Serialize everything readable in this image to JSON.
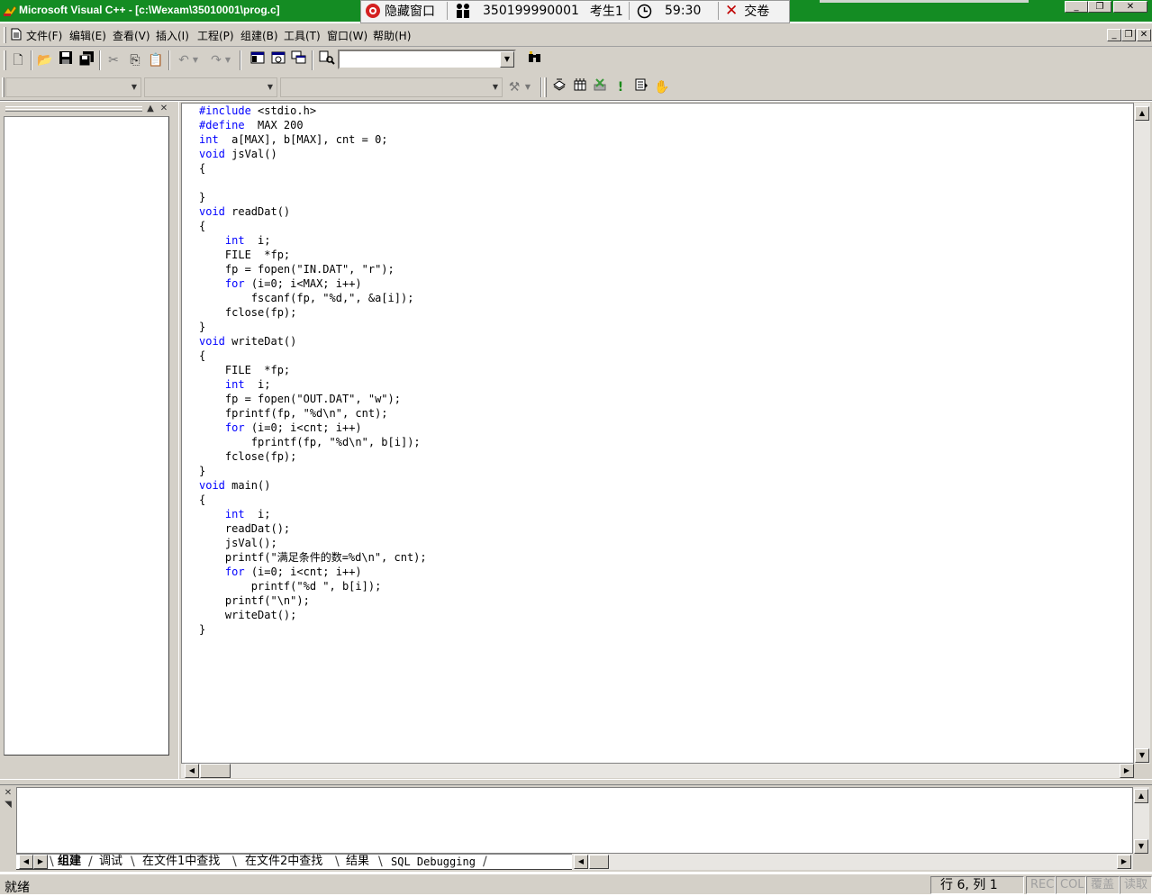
{
  "window": {
    "title": "Microsoft Visual C++ - [c:\\Wexam\\35010001\\prog.c]",
    "minimize": "_",
    "restore": "❐",
    "close": "✕"
  },
  "exam_bar": {
    "hide_label": "隐藏窗口",
    "student_id": "350199990001",
    "student_name": "考生1",
    "timer": "59:30",
    "submit_label": "交卷"
  },
  "menu": {
    "items": [
      "文件(F)",
      "编辑(E)",
      "查看(V)",
      "插入(I)",
      "工程(P)",
      "组建(B)",
      "工具(T)",
      "窗口(W)",
      "帮助(H)"
    ]
  },
  "icons": {
    "new": "new-text-file-icon",
    "open": "open-folder-icon",
    "save": "save-icon",
    "save_all": "save-all-icon",
    "cut": "cut-icon",
    "copy": "copy-icon",
    "paste": "paste-icon",
    "undo": "undo-icon",
    "redo": "redo-icon",
    "workspace": "workspace-icon",
    "output": "output-window-icon",
    "window_list": "window-list-icon",
    "find_in_files": "find-in-files-icon",
    "find": "find-icon",
    "wizard": "wizard-icon",
    "compile": "compile-icon",
    "build": "build-icon",
    "stop_build": "stop-build-icon",
    "execute": "execute-icon",
    "go": "go-icon",
    "breakpoint": "breakpoint-hand-icon"
  },
  "accent_colors": {
    "titlebar": "#148c23",
    "keyword": "#0000ff",
    "chrome": "#d4d0c8"
  },
  "editor": {
    "lines": [
      [
        {
          "t": "#include",
          "k": true
        },
        {
          "t": " <stdio.h>"
        }
      ],
      [
        {
          "t": "#define",
          "k": true
        },
        {
          "t": "  MAX 200"
        }
      ],
      [
        {
          "t": "int",
          "k": true
        },
        {
          "t": "  a[MAX], b[MAX], cnt = 0;"
        }
      ],
      [
        {
          "t": "void",
          "k": true
        },
        {
          "t": " jsVal()"
        }
      ],
      [
        {
          "t": "{"
        }
      ],
      [
        {
          "t": ""
        }
      ],
      [
        {
          "t": "}"
        }
      ],
      [
        {
          "t": "void",
          "k": true
        },
        {
          "t": " readDat()"
        }
      ],
      [
        {
          "t": "{"
        }
      ],
      [
        {
          "t": "    "
        },
        {
          "t": "int",
          "k": true
        },
        {
          "t": "  i;"
        }
      ],
      [
        {
          "t": "    FILE  *fp;"
        }
      ],
      [
        {
          "t": "    fp = fopen(\"IN.DAT\", \"r\");"
        }
      ],
      [
        {
          "t": "    "
        },
        {
          "t": "for",
          "k": true
        },
        {
          "t": " (i=0; i<MAX; i++)"
        }
      ],
      [
        {
          "t": "        fscanf(fp, \"%d,\", &a[i]);"
        }
      ],
      [
        {
          "t": "    fclose(fp);"
        }
      ],
      [
        {
          "t": "}"
        }
      ],
      [
        {
          "t": "void",
          "k": true
        },
        {
          "t": " writeDat()"
        }
      ],
      [
        {
          "t": "{"
        }
      ],
      [
        {
          "t": "    FILE  *fp;"
        }
      ],
      [
        {
          "t": "    "
        },
        {
          "t": "int",
          "k": true
        },
        {
          "t": "  i;"
        }
      ],
      [
        {
          "t": "    fp = fopen(\"OUT.DAT\", \"w\");"
        }
      ],
      [
        {
          "t": "    fprintf(fp, \"%d\\n\", cnt);"
        }
      ],
      [
        {
          "t": "    "
        },
        {
          "t": "for",
          "k": true
        },
        {
          "t": " (i=0; i<cnt; i++)"
        }
      ],
      [
        {
          "t": "        fprintf(fp, \"%d\\n\", b[i]);"
        }
      ],
      [
        {
          "t": "    fclose(fp);"
        }
      ],
      [
        {
          "t": "}"
        }
      ],
      [
        {
          "t": "void",
          "k": true
        },
        {
          "t": " main()"
        }
      ],
      [
        {
          "t": "{"
        }
      ],
      [
        {
          "t": "    "
        },
        {
          "t": "int",
          "k": true
        },
        {
          "t": "  i;"
        }
      ],
      [
        {
          "t": "    readDat();"
        }
      ],
      [
        {
          "t": "    jsVal();"
        }
      ],
      [
        {
          "t": "    printf(\"满足条件的数=%d\\n\", cnt);"
        }
      ],
      [
        {
          "t": "    "
        },
        {
          "t": "for",
          "k": true
        },
        {
          "t": " (i=0; i<cnt; i++)"
        }
      ],
      [
        {
          "t": "        printf(\"%d \", b[i]);"
        }
      ],
      [
        {
          "t": "    printf(\"\\n\");"
        }
      ],
      [
        {
          "t": "    writeDat();"
        }
      ],
      [
        {
          "t": "}"
        }
      ]
    ]
  },
  "output": {
    "tabs": [
      "组建",
      "调试",
      "在文件1中查找",
      "在文件2中查找",
      "结果",
      "SQL Debugging"
    ],
    "active_tab": "组建"
  },
  "status": {
    "text": "就绪",
    "position": "行 6, 列 1",
    "rec": "REC",
    "col": "COL",
    "ovr": "覆盖",
    "read": "读取"
  }
}
